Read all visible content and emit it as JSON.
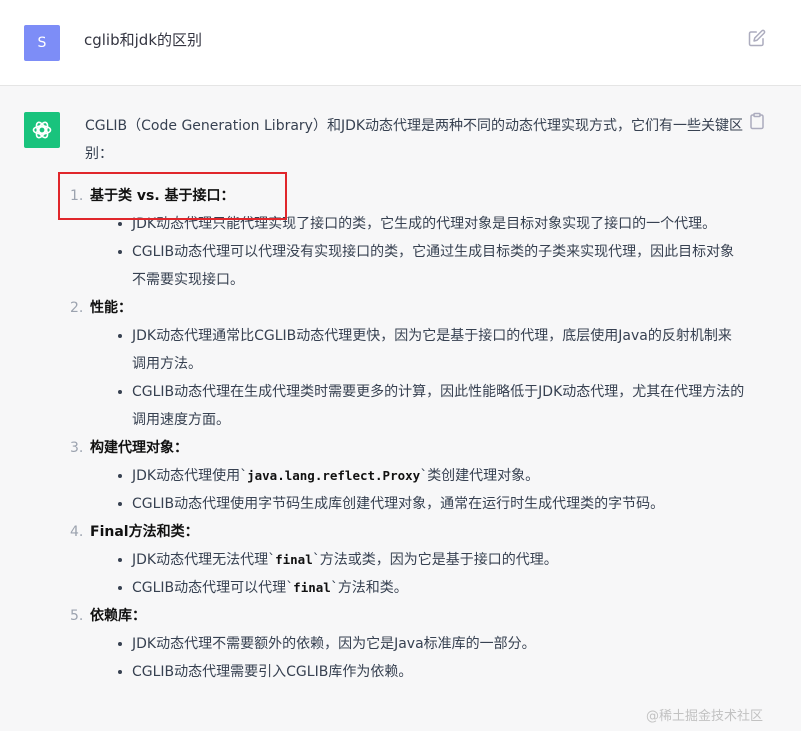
{
  "user": {
    "avatar_letter": "S",
    "message": "cglib和jdk的区别"
  },
  "answer": {
    "intro": "CGLIB（Code Generation Library）和JDK动态代理是两种不同的动态代理实现方式，它们有一些关键区别：",
    "items": [
      {
        "num": "1.",
        "title": "基于类 vs. 基于接口：",
        "points": [
          {
            "text": "JDK动态代理只能代理实现了接口的类，它生成的代理对象是目标对象实现了接口的一个代理。"
          },
          {
            "text": "CGLIB动态代理可以代理没有实现接口的类，它通过生成目标类的子类来实现代理，因此目标对象不需要实现接口。"
          }
        ]
      },
      {
        "num": "2.",
        "title": "性能：",
        "points": [
          {
            "text": "JDK动态代理通常比CGLIB动态代理更快，因为它是基于接口的代理，底层使用Java的反射机制来调用方法。"
          },
          {
            "text": "CGLIB动态代理在生成代理类时需要更多的计算，因此性能略低于JDK动态代理，尤其在代理方法的调用速度方面。"
          }
        ]
      },
      {
        "num": "3.",
        "title": "构建代理对象：",
        "points": [
          {
            "pre": "JDK动态代理使用`",
            "code": "java.lang.reflect.Proxy",
            "post": "`类创建代理对象。"
          },
          {
            "text": "CGLIB动态代理使用字节码生成库创建代理对象，通常在运行时生成代理类的字节码。"
          }
        ]
      },
      {
        "num": "4.",
        "title": "Final方法和类：",
        "points": [
          {
            "pre": "JDK动态代理无法代理`",
            "code": "final",
            "post": "`方法或类，因为它是基于接口的代理。"
          },
          {
            "pre": "CGLIB动态代理可以代理`",
            "code": "final",
            "post": "`方法和类。"
          }
        ]
      },
      {
        "num": "5.",
        "title": "依赖库：",
        "points": [
          {
            "text": "JDK动态代理不需要额外的依赖，因为它是Java标准库的一部分。"
          },
          {
            "text": "CGLIB动态代理需要引入CGLIB库作为依赖。"
          }
        ]
      }
    ]
  },
  "watermark": "@稀土掘金技术社区",
  "colors": {
    "user_avatar": "#7d8df7",
    "bot_avatar": "#19c37d",
    "highlight": "#e0262b"
  }
}
